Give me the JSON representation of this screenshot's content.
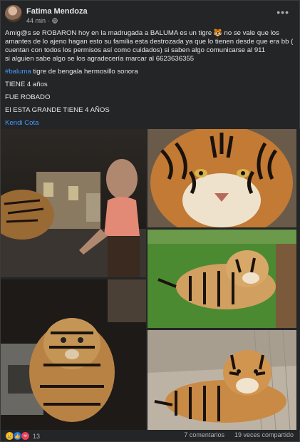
{
  "post": {
    "author": "Fatima Mendoza",
    "time": "44 min",
    "separator": "·",
    "more": "•••",
    "paragraphs": {
      "p1": "Amig@s se ROBARON hoy en la madrugada a BALUMA es un tigre 🐯 no se vale que los amantes de lo ajeno hagan esto su familia esta destrozada ya que lo tienen desde que era bb ( cuentan con todos los permisos así como cuidados) si saben algo comunicarse al 911",
      "p1b": "si alguien sabe algo se los agradecería marcar al 6623636355",
      "hashtag": "#baluma",
      "p2": " tigre de bengala hermosillo sonora",
      "p3": "TIENE 4 años",
      "p4": "FUE ROBADO",
      "p5": "El ESTA GRANDE TIENE 4 AÑOS",
      "mention": "Kendi Cota"
    },
    "footer": {
      "reaction_count": "13",
      "comments": "7 comentarios",
      "shares": "19 veces compartido"
    },
    "colors": {
      "link": "#4599ff",
      "bg": "#242526",
      "text": "#e4e6eb",
      "muted": "#b0b3b8"
    }
  }
}
